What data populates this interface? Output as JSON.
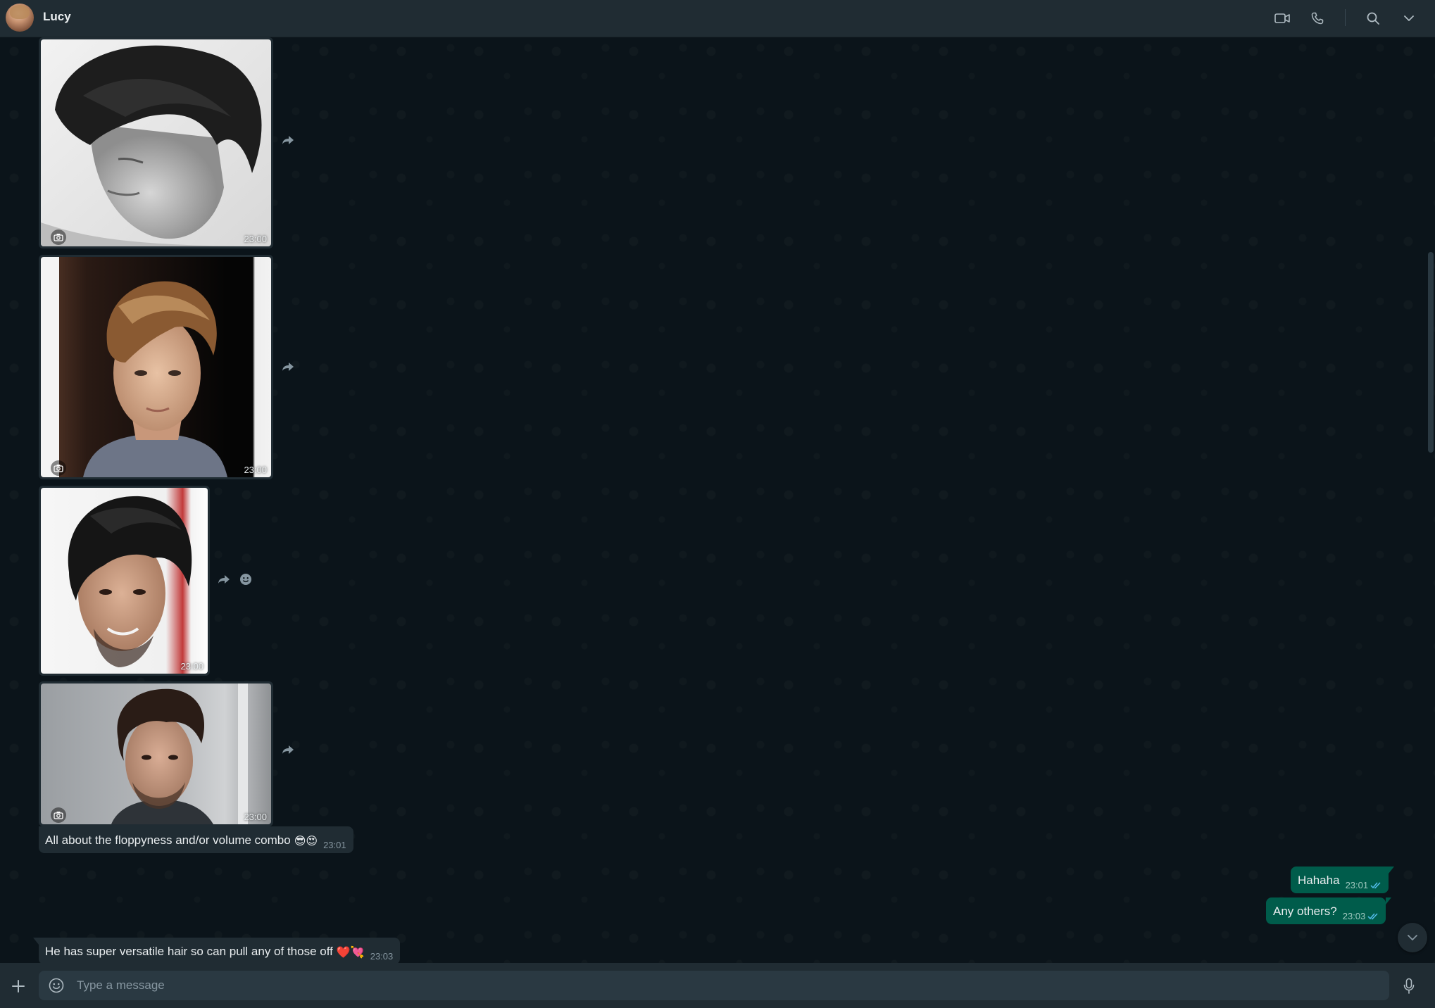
{
  "header": {
    "contact_name": "Lucy"
  },
  "icons": {
    "video": "video-call-icon",
    "phone": "voice-call-icon",
    "search": "search-icon",
    "menu": "chevron-down-icon",
    "attach": "plus-icon",
    "emoji": "emoji-icon",
    "mic": "microphone-icon"
  },
  "messages": {
    "img1_time": "23:00",
    "img2_time": "23:00",
    "img3_time": "23:00",
    "img4_time": "23:00",
    "in1": {
      "text": "All about the floppyness and/or volume combo",
      "emoji": "😎😍",
      "time": "23:01"
    },
    "out1": {
      "text": "Hahaha",
      "time": "23:01"
    },
    "out2": {
      "text": "Any others?",
      "time": "23:03"
    },
    "in2": {
      "text": "He has super versatile hair so can pull any of those off",
      "emoji": "❤️💘",
      "time": "23:03"
    }
  },
  "composer": {
    "placeholder": "Type a message"
  },
  "colors": {
    "background": "#0b141a",
    "header": "#202c33",
    "incoming_bubble": "#202c33",
    "outgoing_bubble": "#005c4b",
    "read_tick": "#53bdeb"
  }
}
